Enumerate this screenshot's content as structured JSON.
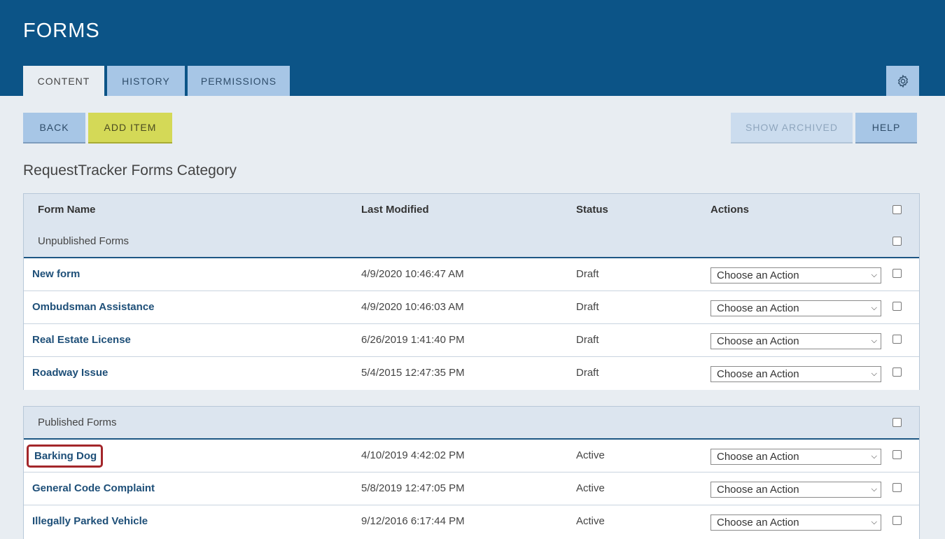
{
  "header": {
    "title": "FORMS",
    "tabs": [
      {
        "label": "CONTENT"
      },
      {
        "label": "HISTORY"
      },
      {
        "label": "PERMISSIONS"
      }
    ]
  },
  "toolbar": {
    "back_label": "BACK",
    "add_label": "ADD ITEM",
    "show_archived_label": "SHOW ARCHIVED",
    "help_label": "HELP"
  },
  "category_title": "RequestTracker Forms Category",
  "columns": {
    "name": "Form Name",
    "modified": "Last Modified",
    "status": "Status",
    "actions": "Actions"
  },
  "action_placeholder": "Choose an Action",
  "unpublished": {
    "label": "Unpublished Forms",
    "rows": [
      {
        "name": "New form",
        "modified": "4/9/2020 10:46:47 AM",
        "status": "Draft"
      },
      {
        "name": "Ombudsman Assistance",
        "modified": "4/9/2020 10:46:03 AM",
        "status": "Draft"
      },
      {
        "name": "Real Estate License",
        "modified": "6/26/2019 1:41:40 PM",
        "status": "Draft"
      },
      {
        "name": "Roadway Issue",
        "modified": "5/4/2015 12:47:35 PM",
        "status": "Draft"
      }
    ]
  },
  "published": {
    "label": "Published Forms",
    "rows": [
      {
        "name": "Barking Dog",
        "modified": "4/10/2019 4:42:02 PM",
        "status": "Active"
      },
      {
        "name": "General Code Complaint",
        "modified": "5/8/2019 12:47:05 PM",
        "status": "Active"
      },
      {
        "name": "Illegally Parked Vehicle",
        "modified": "9/12/2016 6:17:44 PM",
        "status": "Active"
      }
    ]
  },
  "colors": {
    "header_bg": "#0c5487",
    "tab_bg": "#a7c6e6",
    "add_button_bg": "#d4d957",
    "highlight_border": "#a3262a"
  },
  "icons": {
    "settings": "gear-icon",
    "select_chevron": "chevron-down-icon"
  }
}
